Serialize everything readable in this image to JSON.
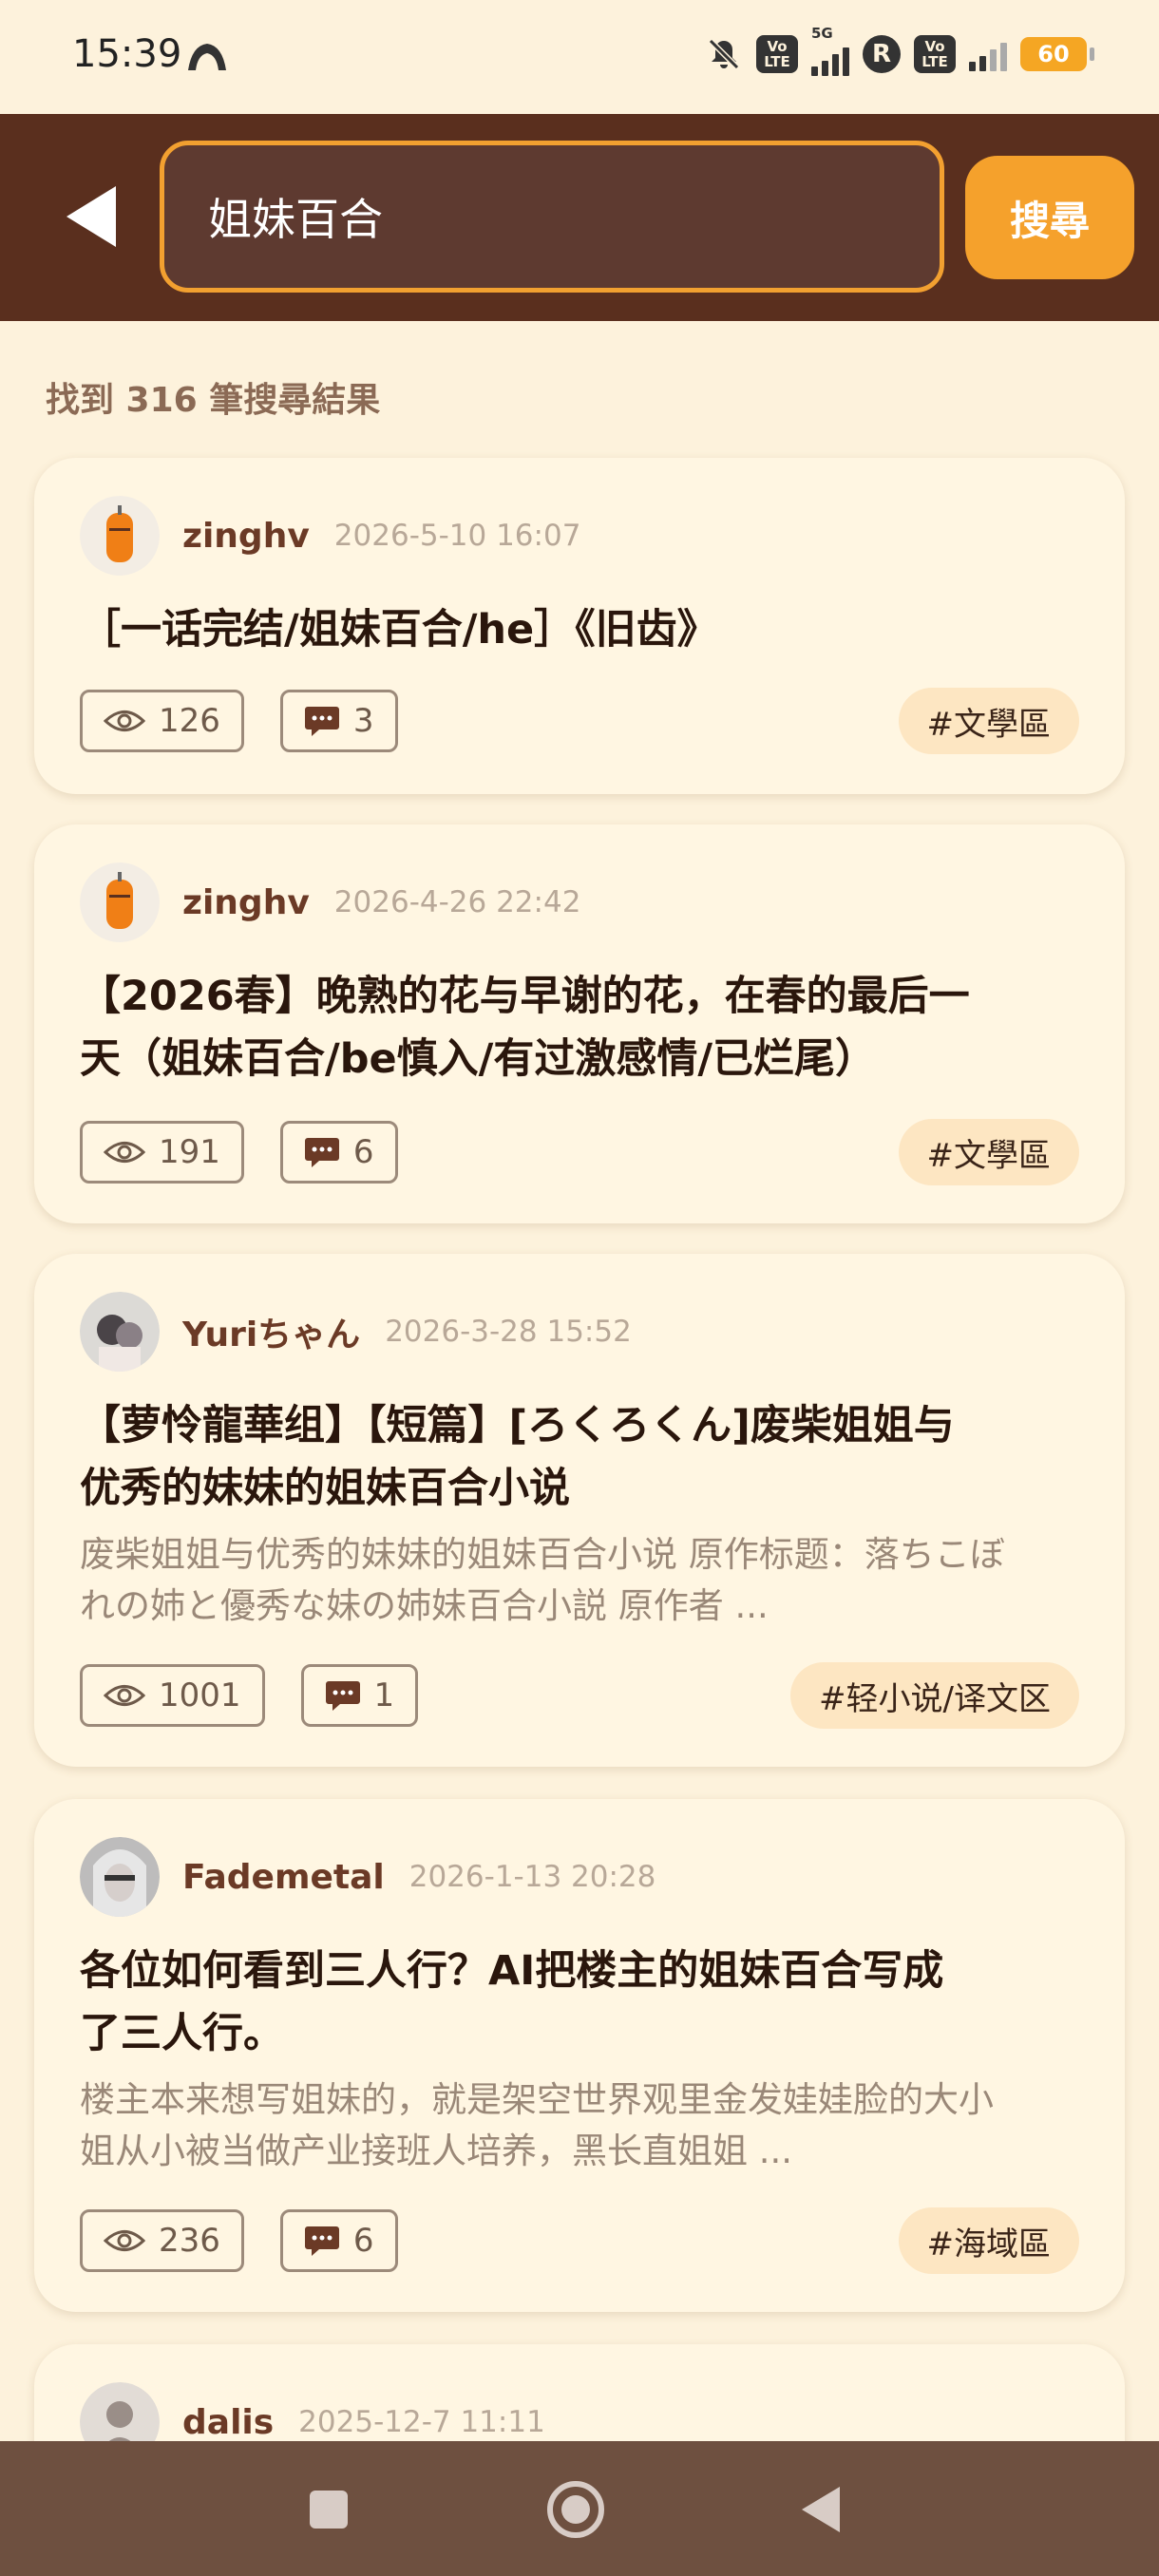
{
  "status_bar": {
    "time": "15:39",
    "battery": "60",
    "lte": "VoLTE",
    "net": "5G",
    "r": "R"
  },
  "search": {
    "back_label": "back",
    "query": "姐妹百合",
    "button_label": "搜尋"
  },
  "results_summary": "找到 316 筆搜尋結果",
  "posts": [
    {
      "author": "zinghv",
      "date": "2026-5-10 16:07",
      "title_lines": [
        "［一话完结/姐妹百合/he］《旧齿》"
      ],
      "excerpt_lines": [],
      "views": "126",
      "comments": "3",
      "tag": "#文學區"
    },
    {
      "author": "zinghv",
      "date": "2026-4-26 22:42",
      "title_lines": [
        "【2026春】晚熟的花与早谢的花，在春的最后一",
        "天（姐妹百合/be慎入/有过激感情/已烂尾）"
      ],
      "excerpt_lines": [],
      "views": "191",
      "comments": "6",
      "tag": "#文學區"
    },
    {
      "author": "Yuriちゃん",
      "date": "2026-3-28 15:52",
      "title_lines": [
        "【萝怜龍華组】【短篇】[ろくろくん]废柴姐姐与",
        "优秀的妹妹的姐妹百合小说"
      ],
      "excerpt_lines": [
        "废柴姐姐与优秀的妹妹的姐妹百合小说 原作标题：落ちこぼ",
        "れの姉と優秀な妹の姉妹百合小説 原作者 ..."
      ],
      "views": "1001",
      "comments": "1",
      "tag": "#轻小说/译文区"
    },
    {
      "author": "Fademetal",
      "date": "2026-1-13 20:28",
      "title_lines": [
        "各位如何看到三人行？AI把楼主的姐妹百合写成",
        "了三人行。"
      ],
      "excerpt_lines": [
        "楼主本来想写姐妹的，就是架空世界观里金发娃娃脸的大小",
        "姐从小被当做产业接班人培养，黑长直姐姐 ..."
      ],
      "views": "236",
      "comments": "6",
      "tag": "#海域區"
    },
    {
      "author": "dalis",
      "date": "2025-12-7 11:11"
    }
  ],
  "colors": {
    "header": "#5a2f1e",
    "accent": "#f5a12c",
    "background": "#fdf2dc",
    "card": "#fff6e2",
    "tag_bg": "#fde6c2",
    "nav": "#6e5040"
  }
}
